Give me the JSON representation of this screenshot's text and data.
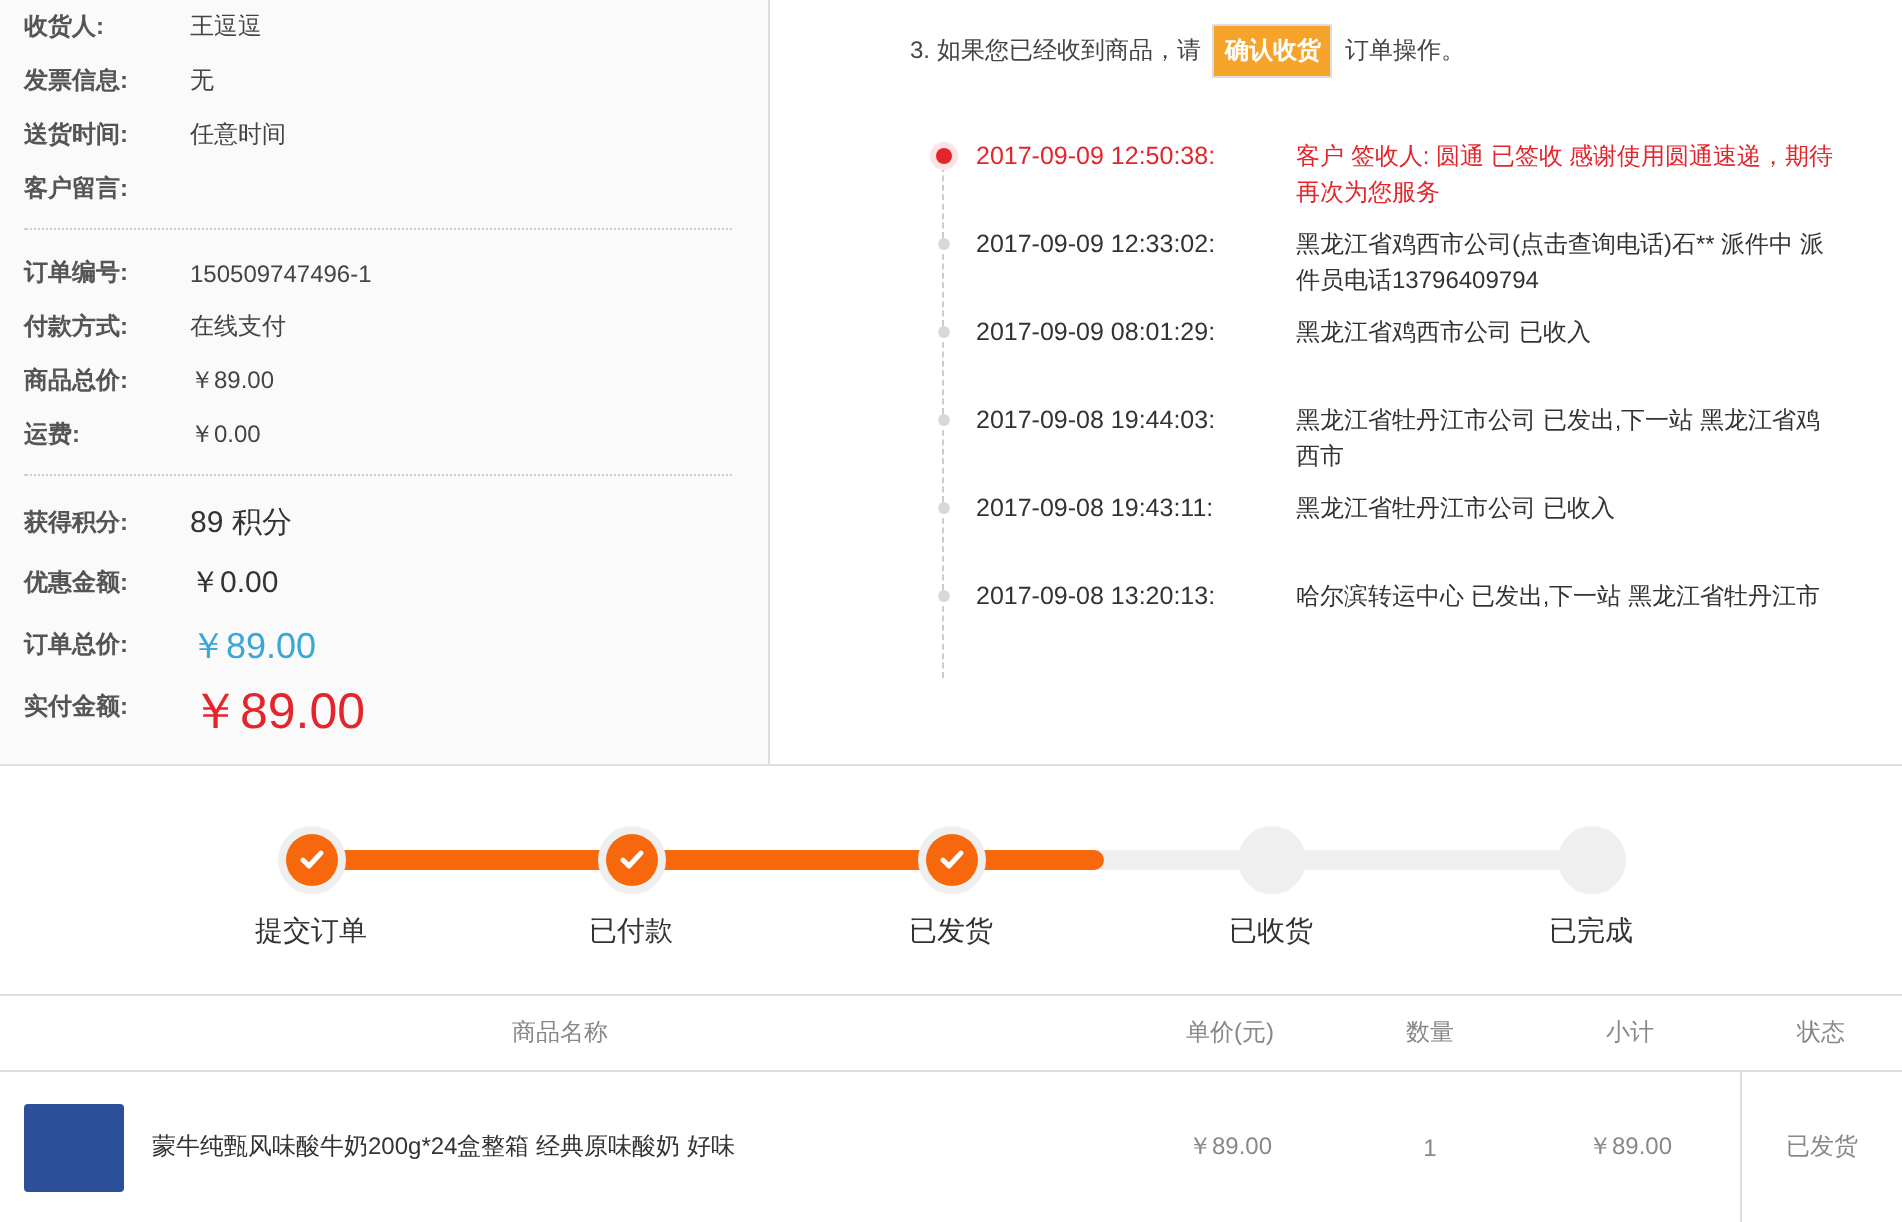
{
  "order_info": {
    "groups": [
      {
        "rows": [
          {
            "label": "收货人:",
            "value": "王逗逗",
            "kind": "plain"
          },
          {
            "label": "发票信息:",
            "value": "无",
            "kind": "plain"
          },
          {
            "label": "送货时间:",
            "value": "任意时间",
            "kind": "plain"
          },
          {
            "label": "客户留言:",
            "kind": "plain"
          }
        ]
      },
      {
        "rows": [
          {
            "label": "订单编号:",
            "value": "150509747496-1",
            "kind": "plain"
          },
          {
            "label": "付款方式:",
            "value": "在线支付",
            "kind": "plain"
          },
          {
            "label": "商品总价:",
            "value": "￥89.00",
            "kind": "plain"
          },
          {
            "label": "运费:",
            "value": "￥0.00",
            "kind": "plain"
          }
        ]
      },
      {
        "rows": [
          {
            "label": "获得积分:",
            "value": "89 积分",
            "kind": "medium"
          },
          {
            "label": "优惠金额:",
            "value": "￥0.00",
            "kind": "medium"
          },
          {
            "label": "订单总价:",
            "value": "￥89.00",
            "kind": "total"
          },
          {
            "label": "实付金额:",
            "value": "￥89.00",
            "kind": "paid"
          }
        ]
      }
    ]
  },
  "instruction": {
    "before": "3. 如果您已经收到商品，请",
    "button": "确认收货",
    "after": "订单操作。"
  },
  "tracking": [
    {
      "time": "2017-09-09 12:50:38:",
      "text": "客户 签收人: 圆通 已签收 感谢使用圆通速递，期待再次为您服务",
      "current": true
    },
    {
      "time": "2017-09-09 12:33:02:",
      "text": "黑龙江省鸡西市公司(点击查询电话)石** 派件中 派件员电话13796409794",
      "current": false
    },
    {
      "time": "2017-09-09 08:01:29:",
      "text": "黑龙江省鸡西市公司 已收入",
      "current": false
    },
    {
      "time": "2017-09-08 19:44:03:",
      "text": "黑龙江省牡丹江市公司 已发出,下一站 黑龙江省鸡西市",
      "current": false
    },
    {
      "time": "2017-09-08 19:43:11:",
      "text": "黑龙江省牡丹江市公司 已收入",
      "current": false
    },
    {
      "time": "2017-09-08 13:20:13:",
      "text": "哈尔滨转运中心 已发出,下一站 黑龙江省牡丹江市",
      "current": false
    }
  ],
  "progress": {
    "level": 0.62,
    "steps": [
      {
        "label": "提交订单",
        "checked": true
      },
      {
        "label": "已付款",
        "checked": true
      },
      {
        "label": "已发货",
        "checked": true
      },
      {
        "label": "已收货",
        "checked": false
      },
      {
        "label": "已完成",
        "checked": false
      }
    ]
  },
  "table": {
    "columns": [
      "商品名称",
      "单价(元)",
      "数量",
      "小计",
      "状态"
    ],
    "rows": [
      {
        "name": "蒙牛纯甄风味酸牛奶200g*24盒整箱 经典原味酸奶 好味",
        "price": "￥89.00",
        "qty": "1",
        "subtotal": "￥89.00",
        "status": "已发货"
      }
    ]
  }
}
